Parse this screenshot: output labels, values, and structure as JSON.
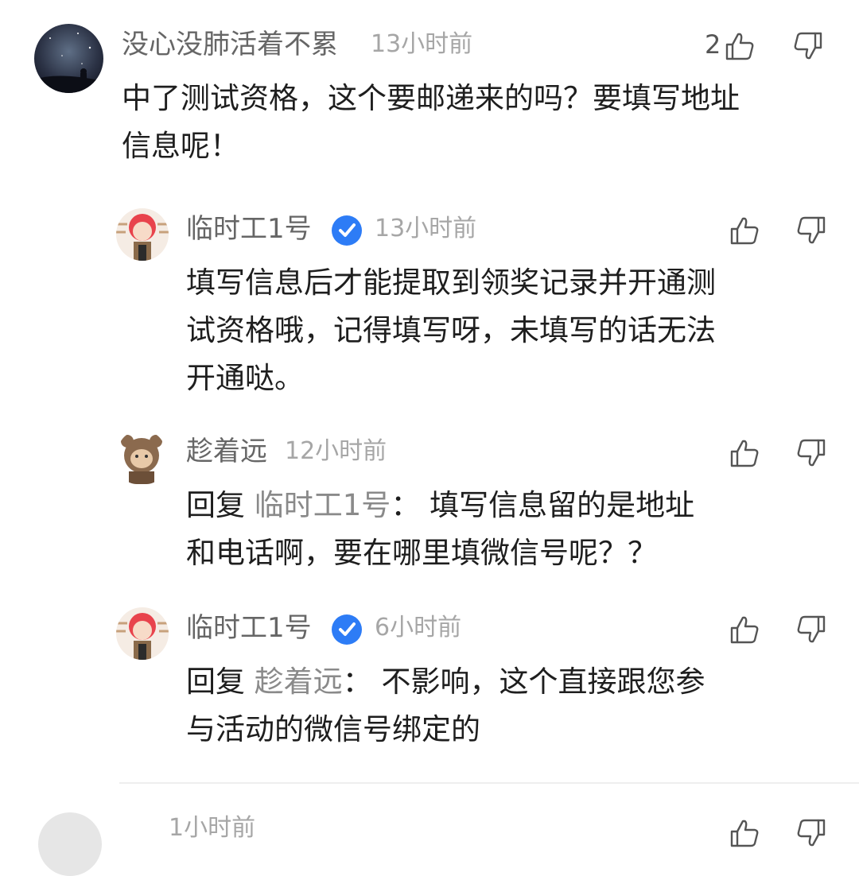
{
  "comments": [
    {
      "username": "没心没肺活着不累",
      "time": "13小时前",
      "like_count": "2",
      "text_lines": [
        "中了测试资格，这个要邮递来的吗？要填写地址",
        "信息呢！"
      ]
    }
  ],
  "replies": [
    {
      "username": "临时工1号",
      "verified": true,
      "time": "13小时前",
      "text_lines": [
        "填写信息后才能提取到领奖记录并开通测",
        "试资格哦，记得填写呀，未填写的话无法",
        "开通哒。"
      ]
    },
    {
      "username": "趁着远",
      "time": "12小时前",
      "reply_prefix": "回复",
      "reply_target": "临时工1号",
      "reply_colon": "：",
      "text_line1": "填写信息留的是地址",
      "text_line2": "和电话啊，要在哪里填微信号呢？？"
    },
    {
      "username": "临时工1号",
      "verified": true,
      "time": "6小时前",
      "reply_prefix": "回复",
      "reply_target": "趁着远",
      "reply_colon": "：",
      "text_line1": "不影响，这个直接跟您参",
      "text_line2": "与活动的微信号绑定的"
    }
  ],
  "next_comment": {
    "time_partial": "1小时前"
  },
  "colors": {
    "verified_badge": "#2d7cf6",
    "username": "#666666",
    "timestamp": "#a6a6a6",
    "text": "#1e1e1e"
  },
  "icons": {
    "like": "thumbs-up-icon",
    "dislike": "thumbs-down-icon",
    "verified": "verified-check-icon"
  }
}
